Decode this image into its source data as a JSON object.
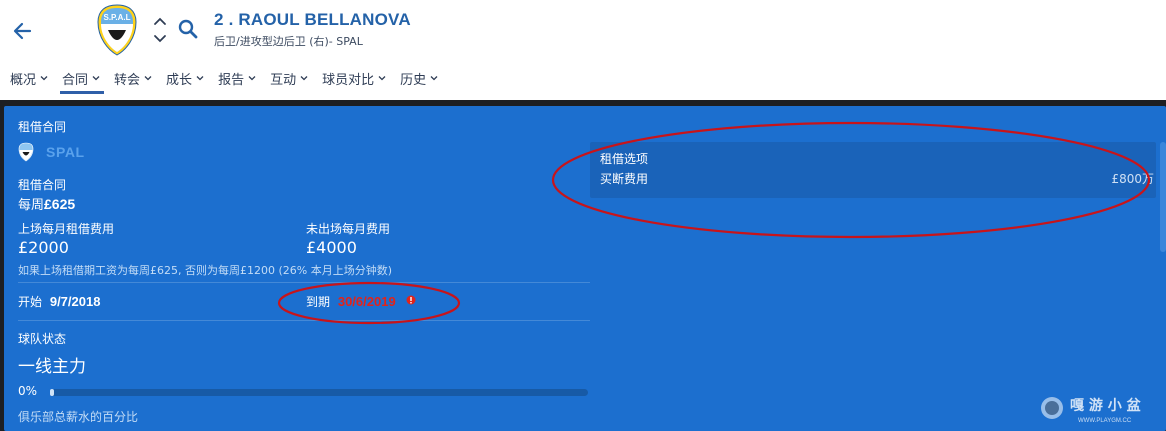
{
  "header": {
    "player_title": "2 . RAOUL BELLANOVA",
    "player_subtitle": "后卫/进攻型边后卫 (右)- SPAL",
    "crest_text": "S.P.A.L",
    "icons": {
      "back": "back-arrow-icon",
      "nav": "chevron-up-down-icon",
      "search": "search-icon"
    },
    "accent_color": "#2462a8"
  },
  "tabs": [
    {
      "label": "概况",
      "active": false
    },
    {
      "label": "合同",
      "active": true
    },
    {
      "label": "转会",
      "active": false
    },
    {
      "label": "成长",
      "active": false
    },
    {
      "label": "报告",
      "active": false
    },
    {
      "label": "互动",
      "active": false
    },
    {
      "label": "球员对比",
      "active": false
    },
    {
      "label": "历史",
      "active": false
    }
  ],
  "panel": {
    "title": "租借合同",
    "club_name": "SPAL",
    "contract_label": "租借合同",
    "weekly_prefix": "每周",
    "weekly_fee": "£625",
    "played_label": "上场每月租借费用",
    "played_value": "£2000",
    "unplayed_label": "未出场每月费用",
    "unplayed_value": "£4000",
    "fee_note": "如果上场租借期工资为每周£625, 否则为每周£1200 (26% 本月上场分钟数)",
    "start_label": "开始",
    "start_date": "9/7/2018",
    "end_label": "到期",
    "end_date": "30/6/2019",
    "squad_status_label": "球队状态",
    "squad_status_value": "一线主力",
    "wage_percent_value": "0%",
    "wage_percent_fraction": 0.0,
    "wage_percent_label": "俱乐部总薪水的百分比",
    "background_color": "#1c6fcf",
    "warning_color": "#e2231a"
  },
  "loan_options": {
    "title": "租借选项",
    "fee_label": "买断费用",
    "fee_value": "£800万"
  },
  "watermark": {
    "text": "嘎 游 小 盆",
    "url_text": "WWW.PLAYGM.CC"
  }
}
